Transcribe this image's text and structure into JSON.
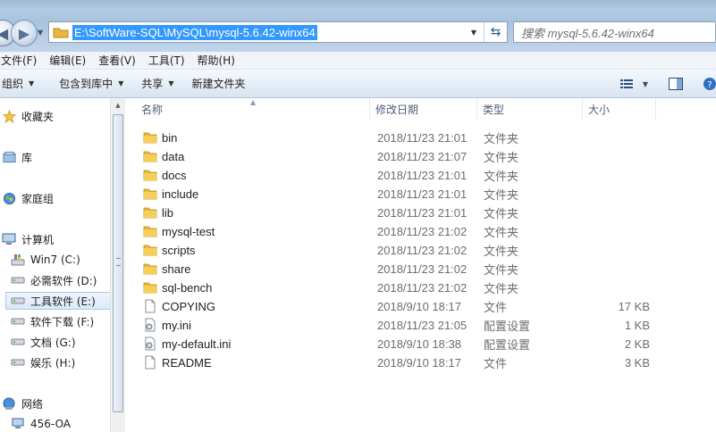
{
  "address": {
    "path": "E:\\SoftWare-SQL\\MySQL\\mysql-5.6.42-winx64"
  },
  "search": {
    "placeholder": "搜索 mysql-5.6.42-winx64"
  },
  "menu": [
    "文件(F)",
    "编辑(E)",
    "查看(V)",
    "工具(T)",
    "帮助(H)"
  ],
  "toolbar": {
    "organize": "组织",
    "include_in_library": "包含到库中",
    "share": "共享",
    "new_folder": "新建文件夹"
  },
  "nav": {
    "favorites": "收藏夹",
    "libraries": "库",
    "homegroup": "家庭组",
    "computer": "计算机",
    "drives": [
      "Win7 (C:)",
      "必需软件 (D:)",
      "工具软件 (E:)",
      "软件下载 (F:)",
      "文档 (G:)",
      "娱乐 (H:)"
    ],
    "selected_drive": "工具软件 (E:)",
    "network": "网络",
    "network_host": "456-OA"
  },
  "columns": {
    "name": "名称",
    "modified": "修改日期",
    "type": "类型",
    "size": "大小"
  },
  "files": [
    {
      "name": "bin",
      "modified": "2018/11/23 21:01",
      "type": "文件夹",
      "size": "",
      "icon": "folder-icon"
    },
    {
      "name": "data",
      "modified": "2018/11/23 21:07",
      "type": "文件夹",
      "size": "",
      "icon": "folder-icon"
    },
    {
      "name": "docs",
      "modified": "2018/11/23 21:01",
      "type": "文件夹",
      "size": "",
      "icon": "folder-icon"
    },
    {
      "name": "include",
      "modified": "2018/11/23 21:01",
      "type": "文件夹",
      "size": "",
      "icon": "folder-icon"
    },
    {
      "name": "lib",
      "modified": "2018/11/23 21:01",
      "type": "文件夹",
      "size": "",
      "icon": "folder-icon"
    },
    {
      "name": "mysql-test",
      "modified": "2018/11/23 21:02",
      "type": "文件夹",
      "size": "",
      "icon": "folder-icon"
    },
    {
      "name": "scripts",
      "modified": "2018/11/23 21:02",
      "type": "文件夹",
      "size": "",
      "icon": "folder-icon"
    },
    {
      "name": "share",
      "modified": "2018/11/23 21:02",
      "type": "文件夹",
      "size": "",
      "icon": "folder-icon"
    },
    {
      "name": "sql-bench",
      "modified": "2018/11/23 21:02",
      "type": "文件夹",
      "size": "",
      "icon": "folder-icon"
    },
    {
      "name": "COPYING",
      "modified": "2018/9/10 18:17",
      "type": "文件",
      "size": "17 KB",
      "icon": "file-icon"
    },
    {
      "name": "my.ini",
      "modified": "2018/11/23 21:05",
      "type": "配置设置",
      "size": "1 KB",
      "icon": "config-file-icon"
    },
    {
      "name": "my-default.ini",
      "modified": "2018/9/10 18:38",
      "type": "配置设置",
      "size": "2 KB",
      "icon": "config-file-icon"
    },
    {
      "name": "README",
      "modified": "2018/9/10 18:17",
      "type": "文件",
      "size": "3 KB",
      "icon": "file-icon"
    }
  ],
  "colors": {
    "selection": "#3399ff",
    "folder": "#e8b73c",
    "header_text": "#4c607a"
  }
}
